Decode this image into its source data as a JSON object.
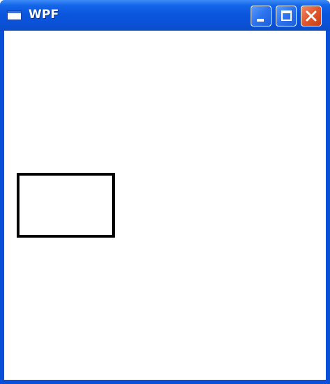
{
  "window": {
    "title": "WPF",
    "titlebar_color": "#0a52d8",
    "client_background": "#ffffff"
  },
  "controls": {
    "minimize_icon": "minimize-icon",
    "maximize_icon": "maximize-icon",
    "close_icon": "close-icon"
  },
  "content": {
    "shape": "rectangle",
    "stroke_color": "#000000",
    "fill": "none"
  }
}
